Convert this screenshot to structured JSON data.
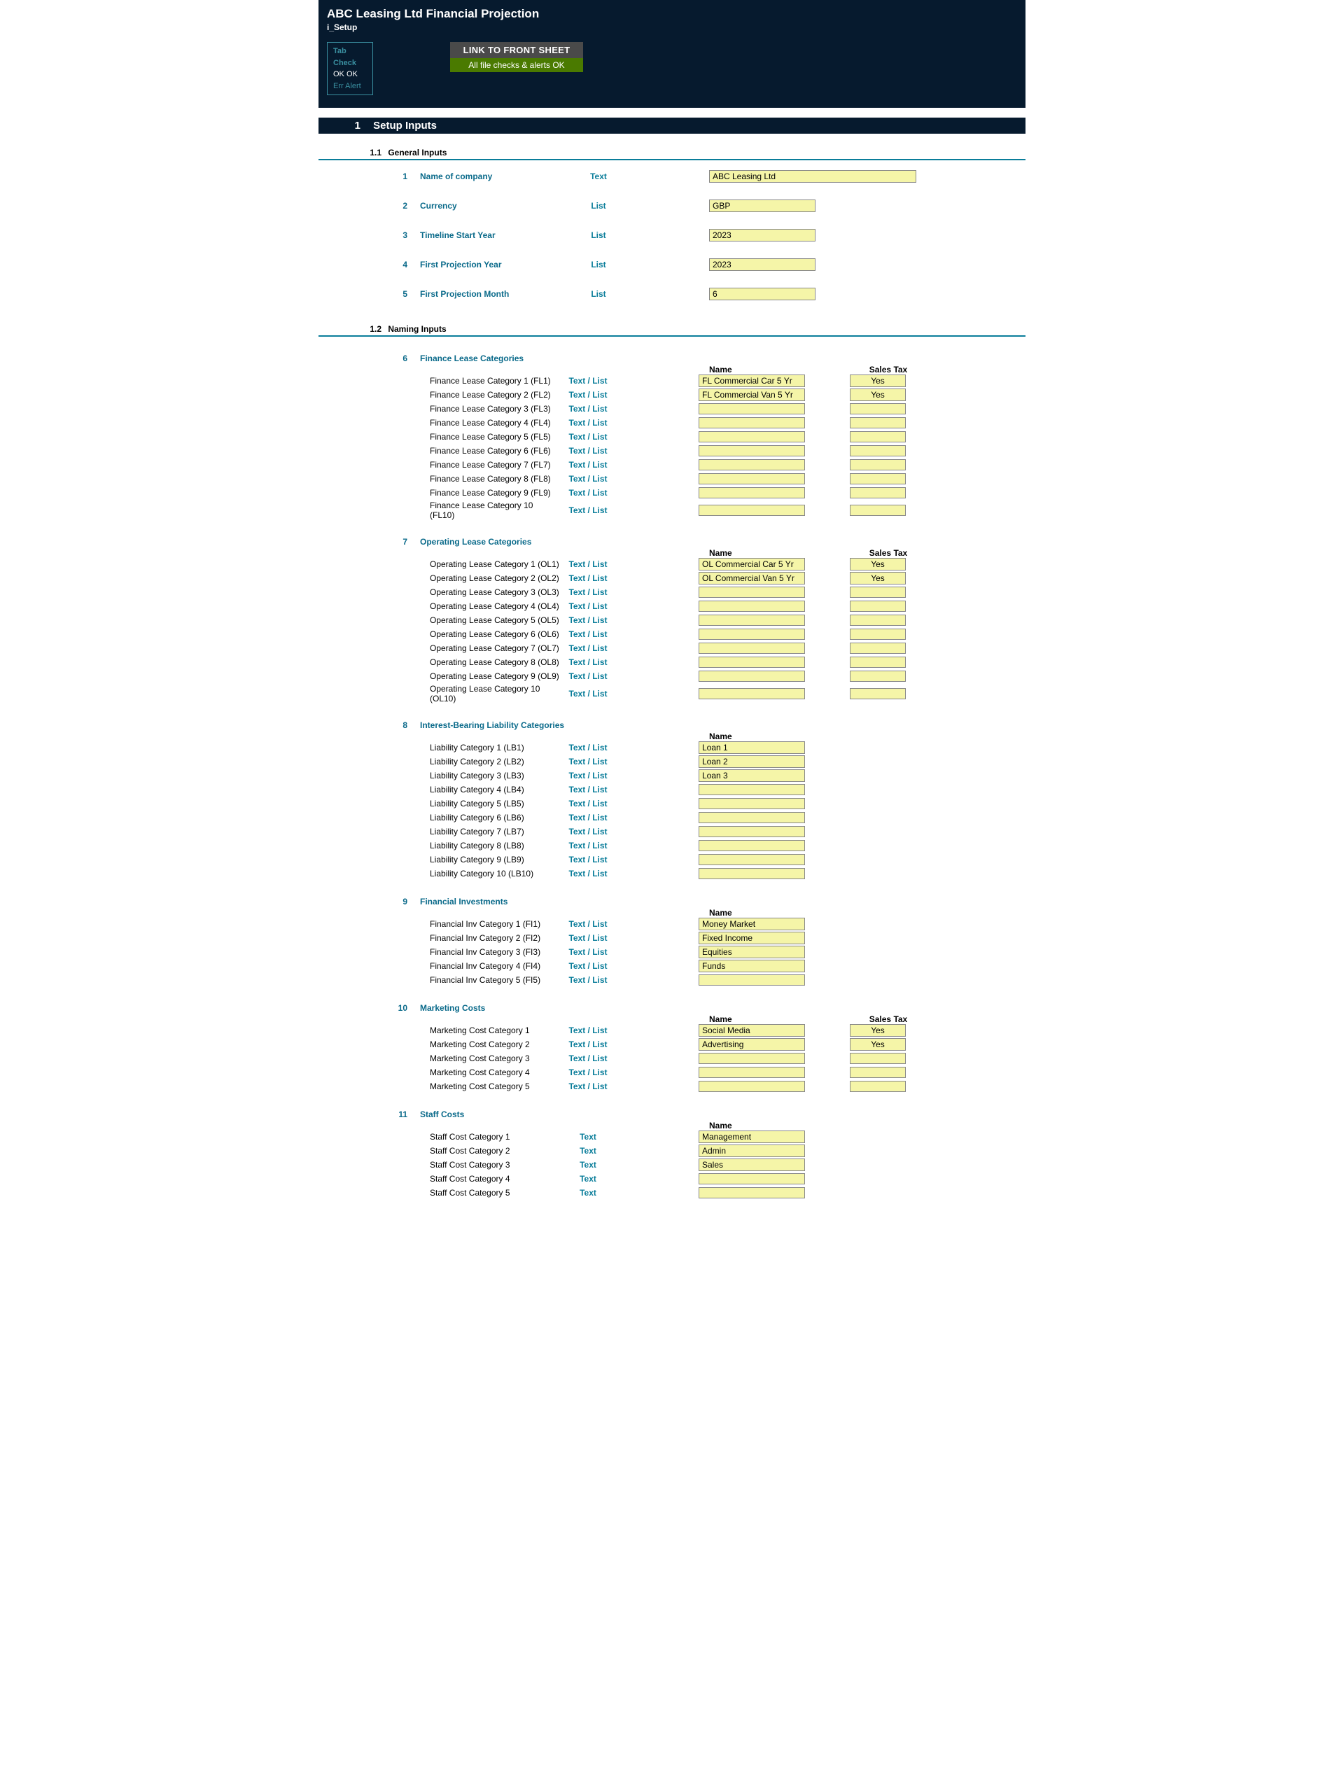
{
  "header": {
    "title": "ABC Leasing Ltd Financial Projection",
    "subtitle": "i_Setup",
    "tabcheck": {
      "title": "Tab Check",
      "row1": "OK   OK",
      "row2": "Err   Alert"
    },
    "linkbox": {
      "top": "LINK TO FRONT SHEET",
      "bot": "All file checks & alerts OK"
    }
  },
  "section": {
    "num": "1",
    "title": "Setup Inputs"
  },
  "sub1": {
    "num": "1.1",
    "title": "General Inputs"
  },
  "general": [
    {
      "n": "1",
      "label": "Name of company",
      "type": "Text",
      "value": "ABC Leasing Ltd",
      "wide": true
    },
    {
      "n": "2",
      "label": "Currency",
      "type": "List",
      "value": "GBP"
    },
    {
      "n": "3",
      "label": "Timeline Start Year",
      "type": "List",
      "value": "2023"
    },
    {
      "n": "4",
      "label": "First Projection Year",
      "type": "List",
      "value": "2023"
    },
    {
      "n": "5",
      "label": "First Projection Month",
      "type": "List",
      "value": "6"
    }
  ],
  "sub2": {
    "num": "1.2",
    "title": "Naming Inputs"
  },
  "headers": {
    "name": "Name",
    "tax": "Sales Tax"
  },
  "groups": [
    {
      "n": "6",
      "title": "Finance Lease Categories",
      "hasTax": true,
      "rows": [
        {
          "label": "Finance Lease Category 1 (FL1)",
          "type": "Text / List",
          "name": "FL Commercial Car 5 Yr",
          "tax": "Yes"
        },
        {
          "label": "Finance Lease Category 2 (FL2)",
          "type": "Text / List",
          "name": "FL Commercial Van 5 Yr",
          "tax": "Yes"
        },
        {
          "label": "Finance Lease Category 3 (FL3)",
          "type": "Text / List",
          "name": "",
          "tax": ""
        },
        {
          "label": "Finance Lease Category 4 (FL4)",
          "type": "Text / List",
          "name": "",
          "tax": ""
        },
        {
          "label": "Finance Lease Category 5 (FL5)",
          "type": "Text / List",
          "name": "",
          "tax": ""
        },
        {
          "label": "Finance Lease Category 6 (FL6)",
          "type": "Text / List",
          "name": "",
          "tax": ""
        },
        {
          "label": "Finance Lease Category 7 (FL7)",
          "type": "Text / List",
          "name": "",
          "tax": ""
        },
        {
          "label": "Finance Lease Category 8 (FL8)",
          "type": "Text / List",
          "name": "",
          "tax": ""
        },
        {
          "label": "Finance Lease Category 9 (FL9)",
          "type": "Text / List",
          "name": "",
          "tax": ""
        },
        {
          "label": "Finance Lease Category 10 (FL10)",
          "type": "Text / List",
          "name": "",
          "tax": ""
        }
      ]
    },
    {
      "n": "7",
      "title": "Operating Lease Categories",
      "hasTax": true,
      "rows": [
        {
          "label": "Operating Lease Category 1 (OL1)",
          "type": "Text / List",
          "name": "OL Commercial Car 5 Yr",
          "tax": "Yes"
        },
        {
          "label": "Operating Lease Category 2 (OL2)",
          "type": "Text / List",
          "name": "OL Commercial Van 5 Yr",
          "tax": "Yes"
        },
        {
          "label": "Operating Lease Category 3 (OL3)",
          "type": "Text / List",
          "name": "",
          "tax": ""
        },
        {
          "label": "Operating Lease Category 4 (OL4)",
          "type": "Text / List",
          "name": "",
          "tax": ""
        },
        {
          "label": "Operating Lease Category 5 (OL5)",
          "type": "Text / List",
          "name": "",
          "tax": ""
        },
        {
          "label": "Operating Lease Category 6 (OL6)",
          "type": "Text / List",
          "name": "",
          "tax": ""
        },
        {
          "label": "Operating Lease Category 7 (OL7)",
          "type": "Text / List",
          "name": "",
          "tax": ""
        },
        {
          "label": "Operating Lease Category 8 (OL8)",
          "type": "Text / List",
          "name": "",
          "tax": ""
        },
        {
          "label": "Operating Lease Category 9 (OL9)",
          "type": "Text / List",
          "name": "",
          "tax": ""
        },
        {
          "label": "Operating Lease Category 10 (OL10)",
          "type": "Text / List",
          "name": "",
          "tax": ""
        }
      ]
    },
    {
      "n": "8",
      "title": "Interest-Bearing Liability Categories",
      "hasTax": false,
      "rows": [
        {
          "label": "Liability Category 1 (LB1)",
          "type": "Text / List",
          "name": "Loan 1"
        },
        {
          "label": "Liability Category 2 (LB2)",
          "type": "Text / List",
          "name": "Loan 2"
        },
        {
          "label": "Liability Category 3 (LB3)",
          "type": "Text / List",
          "name": "Loan 3"
        },
        {
          "label": "Liability Category 4 (LB4)",
          "type": "Text / List",
          "name": ""
        },
        {
          "label": "Liability Category 5 (LB5)",
          "type": "Text / List",
          "name": ""
        },
        {
          "label": "Liability Category 6 (LB6)",
          "type": "Text / List",
          "name": ""
        },
        {
          "label": "Liability Category 7 (LB7)",
          "type": "Text / List",
          "name": ""
        },
        {
          "label": "Liability Category 8 (LB8)",
          "type": "Text / List",
          "name": ""
        },
        {
          "label": "Liability Category 9 (LB9)",
          "type": "Text / List",
          "name": ""
        },
        {
          "label": "Liability Category 10 (LB10)",
          "type": "Text / List",
          "name": ""
        }
      ]
    },
    {
      "n": "9",
      "title": "Financial Investments",
      "hasTax": false,
      "rows": [
        {
          "label": "Financial Inv Category 1 (FI1)",
          "type": "Text / List",
          "name": "Money Market"
        },
        {
          "label": "Financial Inv Category 2 (FI2)",
          "type": "Text / List",
          "name": "Fixed Income"
        },
        {
          "label": "Financial Inv Category 3 (FI3)",
          "type": "Text / List",
          "name": "Equities"
        },
        {
          "label": "Financial Inv Category 4 (FI4)",
          "type": "Text / List",
          "name": "Funds"
        },
        {
          "label": "Financial Inv Category 5 (FI5)",
          "type": "Text / List",
          "name": ""
        }
      ]
    },
    {
      "n": "10",
      "title": "Marketing Costs",
      "hasTax": true,
      "rows": [
        {
          "label": "Marketing Cost Category 1",
          "type": "Text / List",
          "name": "Social Media",
          "tax": "Yes"
        },
        {
          "label": "Marketing Cost Category 2",
          "type": "Text / List",
          "name": "Advertising",
          "tax": "Yes"
        },
        {
          "label": "Marketing Cost Category 3",
          "type": "Text / List",
          "name": "",
          "tax": ""
        },
        {
          "label": "Marketing Cost Category 4",
          "type": "Text / List",
          "name": "",
          "tax": ""
        },
        {
          "label": "Marketing Cost Category 5",
          "type": "Text / List",
          "name": "",
          "tax": ""
        }
      ]
    },
    {
      "n": "11",
      "title": "Staff Costs",
      "hasTax": false,
      "rows": [
        {
          "label": "Staff Cost Category 1",
          "type": "Text",
          "name": "Management"
        },
        {
          "label": "Staff Cost Category 2",
          "type": "Text",
          "name": "Admin"
        },
        {
          "label": "Staff Cost Category 3",
          "type": "Text",
          "name": "Sales"
        },
        {
          "label": "Staff Cost Category 4",
          "type": "Text",
          "name": ""
        },
        {
          "label": "Staff Cost Category 5",
          "type": "Text",
          "name": ""
        }
      ]
    }
  ]
}
